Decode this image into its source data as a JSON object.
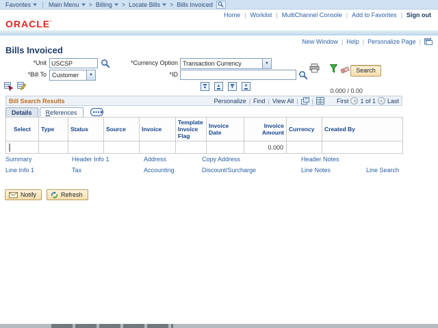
{
  "separators": {
    "pipe": "|",
    "gt": ">"
  },
  "breadcrumb": {
    "favorites": "Favorites",
    "main_menu": "Main Menu",
    "billing": "Billing",
    "locate_bills": "Locate Bills",
    "current": "Bills Invoiced"
  },
  "top_nav": {
    "home": "Home",
    "worklist": "Worklist",
    "multichannel": "MultiChannel Console",
    "add_to_favorites": "Add to Favorites",
    "sign_out": "Sign out"
  },
  "brand": "ORACLE",
  "page_links": {
    "new_window": "New Window",
    "help": "Help",
    "personalize_page": "Personalize Page"
  },
  "page_title": "Bills Invoiced",
  "form": {
    "unit_label": "*Unit",
    "unit_value": "USCSP",
    "currency_label": "*Currency Option",
    "currency_value": "Transaction Currency",
    "billto_label": "*Bill To",
    "billto_value": "Customer",
    "id_label": "*ID",
    "id_value": "",
    "search_label": "Search"
  },
  "totals": "0.000  /  0.00",
  "results": {
    "title": "Bill Search Results",
    "personalize": "Personalize",
    "find": "Find",
    "view_all": "View All",
    "first_label": "First",
    "page_count": "1 of 1",
    "last_label": "Last",
    "details_tab": "Details",
    "references_tab": "References",
    "columns": [
      "Select",
      "Type",
      "Status",
      "Source",
      "Invoice",
      "Template Invoice Flag",
      "Invoice Date",
      "Invoice Amount",
      "Currency",
      "Created By"
    ],
    "row": {
      "invoice_amount": "0.000"
    }
  },
  "link_rows": [
    [
      "Summary",
      "Header Info 1",
      "Address",
      "Copy Address",
      "Header Notes",
      ""
    ],
    [
      "Line Info 1",
      "Tax",
      "Accounting",
      "Discount/Surcharge",
      "Line Notes",
      "Line Search"
    ]
  ],
  "footer": {
    "notify": "Notify",
    "refresh": "Refresh"
  },
  "colors": {
    "crumb_bar": "#cfe1f2",
    "link_blue": "#2a5fa5",
    "title_navy": "#1d3c6d",
    "oracle_red": "#e2231a",
    "results_orange": "#bf6c1f",
    "button_tan": "#f7dfae",
    "header_text": "#15428b"
  }
}
